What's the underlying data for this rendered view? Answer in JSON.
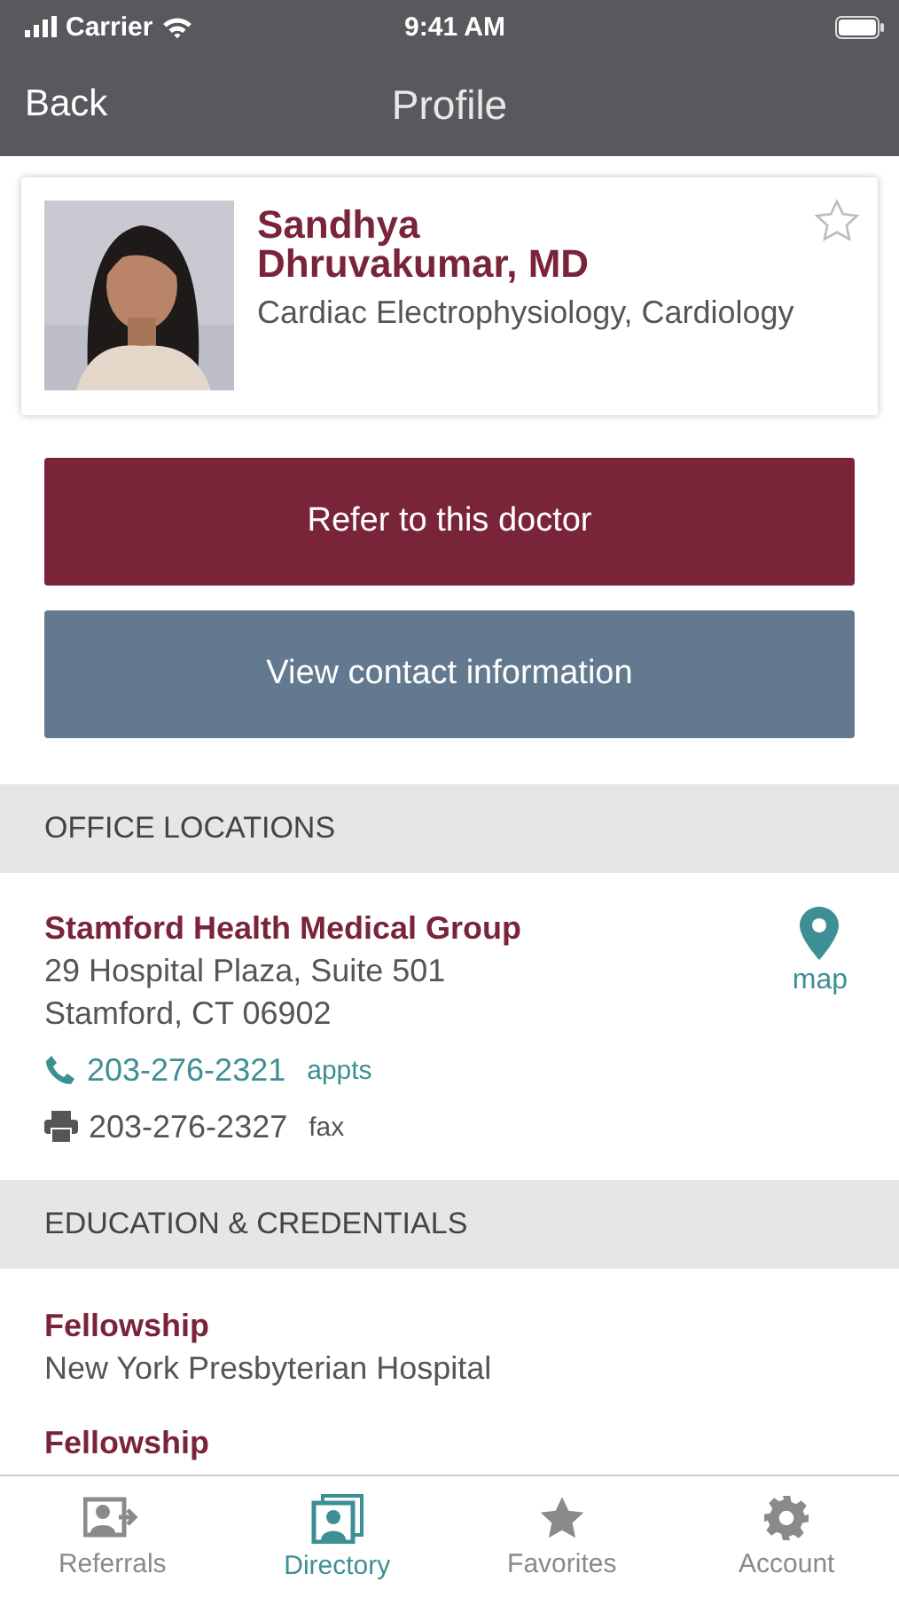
{
  "status_bar": {
    "carrier": "Carrier",
    "time": "9:41 AM"
  },
  "nav": {
    "back": "Back",
    "title": "Profile"
  },
  "profile": {
    "name": "Sandhya Dhruvakumar, MD",
    "specialty": "Cardiac Electrophysiology, Cardiology",
    "favorite": false
  },
  "actions": [
    {
      "label": "Refer to this doctor",
      "kind": "primary"
    },
    {
      "label": "View contact information",
      "kind": "secondary"
    }
  ],
  "office_locations": {
    "heading": "OFFICE LOCATIONS",
    "locations": [
      {
        "name": "Stamford Health Medical Group",
        "address_lines": [
          "29 Hospital Plaza, Suite 501",
          "Stamford, CT 06902"
        ],
        "map_label": "map",
        "phones": [
          {
            "kind": "phone",
            "number": "203-276-2321",
            "label": "appts"
          },
          {
            "kind": "fax",
            "number": "203-276-2327",
            "label": "fax"
          }
        ]
      }
    ]
  },
  "education": {
    "heading": "EDUCATION & CREDENTIALS",
    "items": [
      {
        "title": "Fellowship",
        "detail": "New York Presbyterian Hospital"
      },
      {
        "title": "Fellowship"
      }
    ]
  },
  "tab_bar": [
    {
      "label": "Referrals",
      "kind": "referrals",
      "selected": false
    },
    {
      "label": "Directory",
      "kind": "directory",
      "selected": true
    },
    {
      "label": "Favorites",
      "kind": "favorites",
      "selected": false
    },
    {
      "label": "Account",
      "kind": "account",
      "selected": false
    }
  ]
}
